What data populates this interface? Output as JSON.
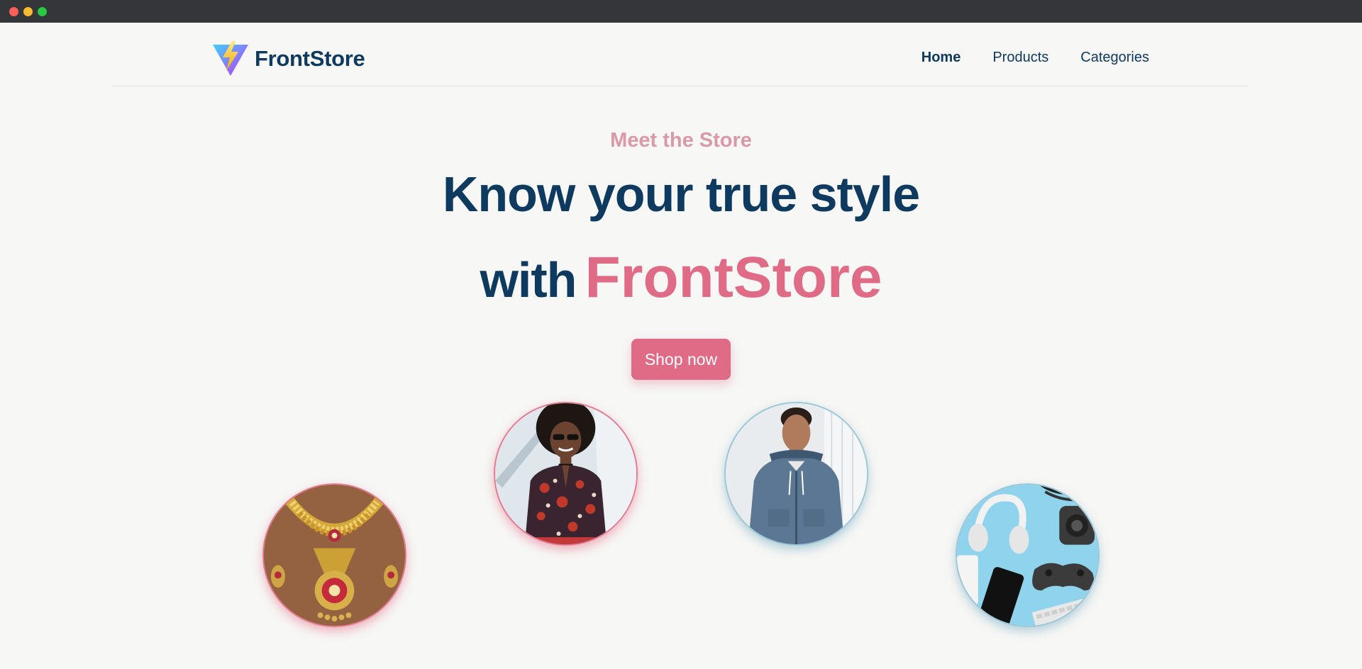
{
  "window": {
    "controls": [
      "close",
      "minimize",
      "maximize"
    ]
  },
  "header": {
    "brand": "FrontStore",
    "logo_icon": "lightning-triangle-icon",
    "nav": [
      {
        "label": "Home",
        "active": true
      },
      {
        "label": "Products",
        "active": false
      },
      {
        "label": "Categories",
        "active": false
      }
    ]
  },
  "hero": {
    "eyebrow": "Meet the Store",
    "headline_line1": "Know your true style",
    "headline_with": "with",
    "headline_brand": "FrontStore",
    "cta_label": "Shop now"
  },
  "gallery": [
    {
      "subject": "gold-necklace-jewelry",
      "ring_color": "#e57990"
    },
    {
      "subject": "woman-floral-blouse",
      "ring_color": "#e57990"
    },
    {
      "subject": "man-blue-hoodie",
      "ring_color": "#9ac7d6"
    },
    {
      "subject": "electronics-headphones-gamepad",
      "ring_color": "#9ac7d6"
    }
  ],
  "colors": {
    "navy": "#0f3a60",
    "pink": "#e06b86",
    "eyebrow_pink": "#d999a8",
    "background": "#f7f7f5"
  }
}
